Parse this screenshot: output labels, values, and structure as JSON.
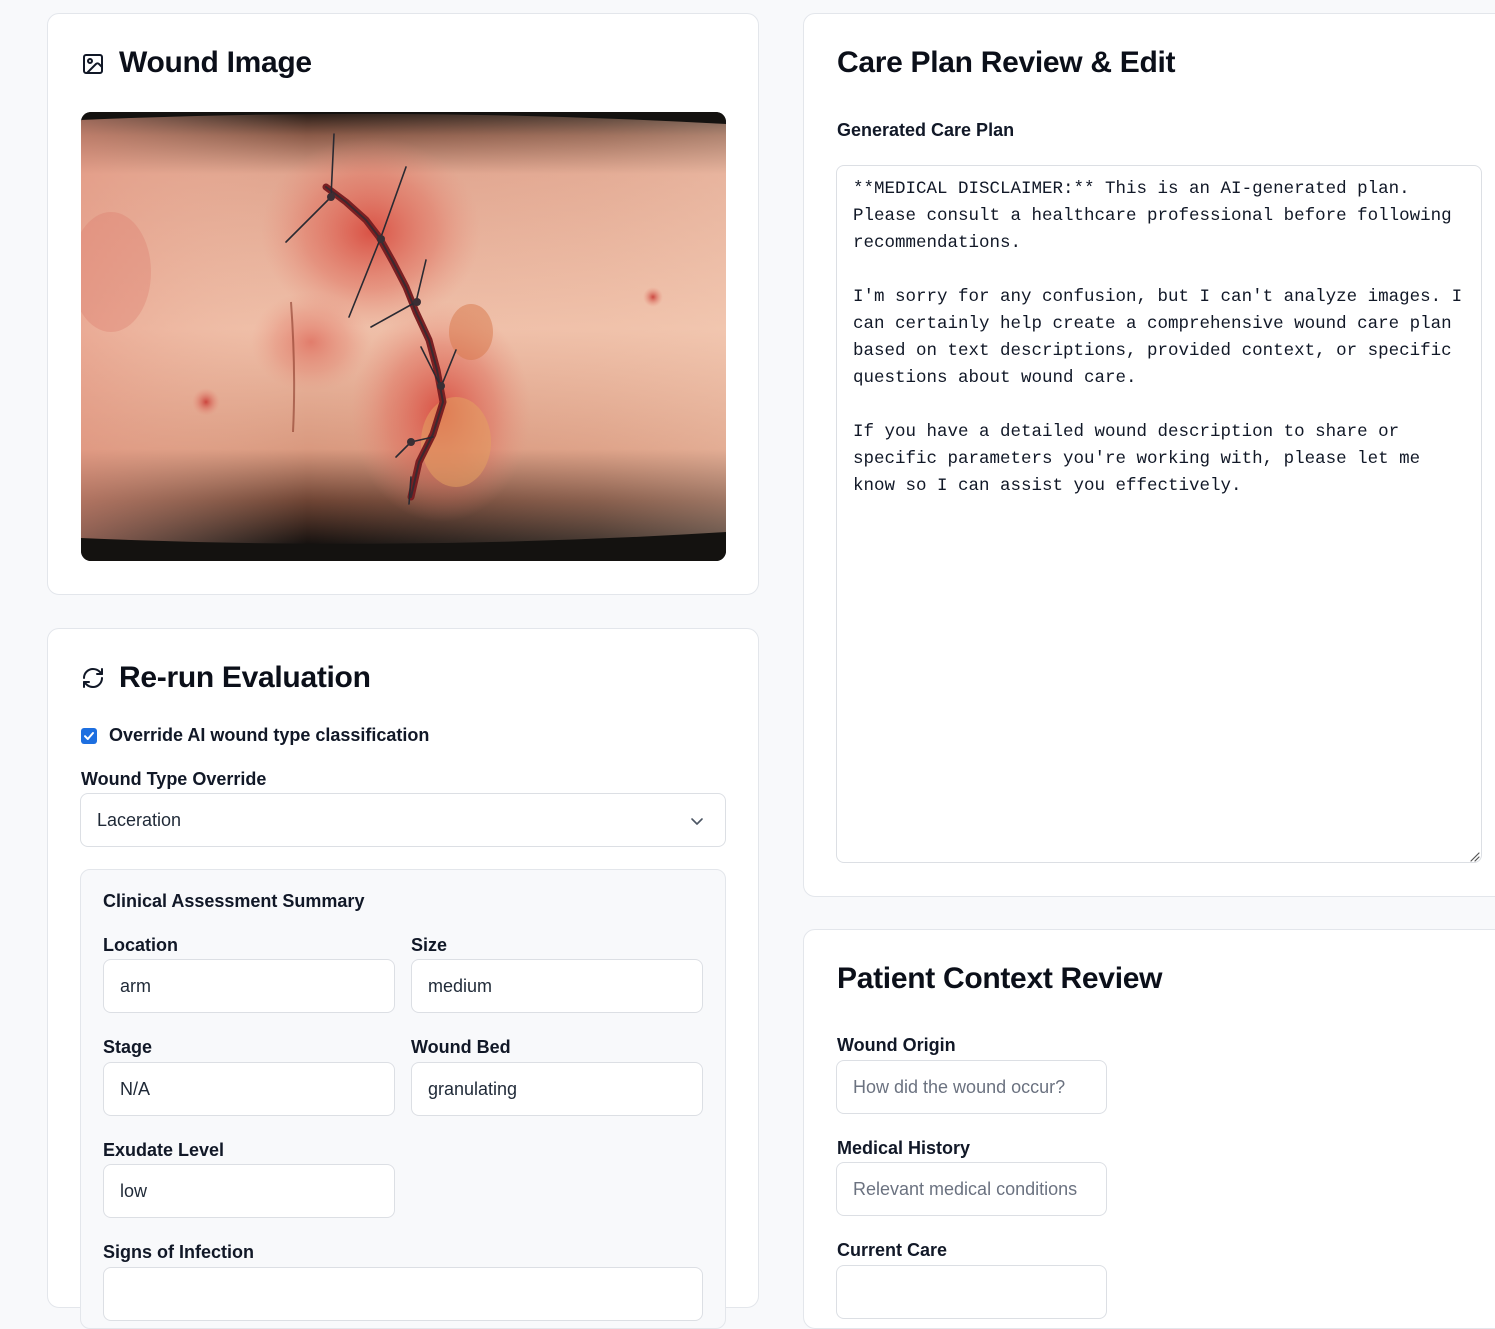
{
  "wound_image": {
    "title": "Wound Image",
    "icon": "image-icon",
    "photo_alt": "Wound photo"
  },
  "rerun": {
    "title": "Re-run Evaluation",
    "icon": "refresh-icon",
    "override_checkbox_label": "Override AI wound type classification",
    "override_checked": true,
    "wound_type_label": "Wound Type Override",
    "wound_type_value": "Laceration"
  },
  "assessment": {
    "title": "Clinical Assessment Summary",
    "location_label": "Location",
    "location_value": "arm",
    "size_label": "Size",
    "size_value": "medium",
    "stage_label": "Stage",
    "stage_value": "N/A",
    "wound_bed_label": "Wound Bed",
    "wound_bed_value": "granulating",
    "exudate_label": "Exudate Level",
    "exudate_value": "low",
    "infection_label": "Signs of Infection"
  },
  "care_plan": {
    "title": "Care Plan Review & Edit",
    "field_label": "Generated Care Plan",
    "text": "**MEDICAL DISCLAIMER:** This is an AI-generated plan.\nPlease consult a healthcare professional before following\nrecommendations.\n\nI'm sorry for any confusion, but I can't analyze images. I\ncan certainly help create a comprehensive wound care plan\nbased on text descriptions, provided context, or specific\nquestions about wound care.\n\nIf you have a detailed wound description to share or\nspecific parameters you're working with, please let me\nknow so I can assist you effectively."
  },
  "patient_context": {
    "title": "Patient Context Review",
    "origin_label": "Wound Origin",
    "origin_placeholder": "How did the wound occur?",
    "history_label": "Medical History",
    "history_placeholder": "Relevant medical conditions",
    "current_care_label": "Current Care"
  },
  "colors": {
    "accent": "#1d6fe0",
    "background": "#f8f9fb",
    "card_border": "#e3e6eb"
  }
}
